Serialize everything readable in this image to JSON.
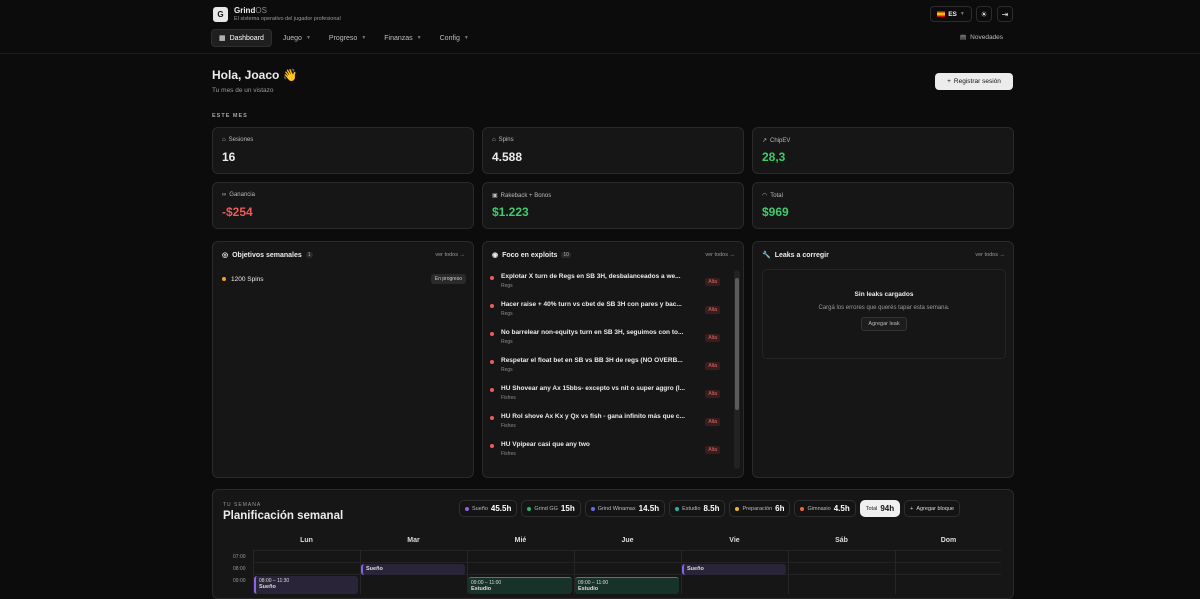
{
  "header": {
    "logo_letter": "G",
    "brand": "Grind",
    "brand_suffix": "OS",
    "tagline": "El sistema operativo del jugador profesional",
    "lang": "ES",
    "nav": [
      {
        "label": "Dashboard",
        "active": true
      },
      {
        "label": "Juego"
      },
      {
        "label": "Progreso"
      },
      {
        "label": "Finanzas"
      },
      {
        "label": "Config"
      }
    ],
    "novedades": "Novedades"
  },
  "greeting": {
    "title": "Hola, Joaco",
    "emoji": "👋",
    "subtitle": "Tu mes de un vistazo",
    "register_button": "Registrar sesión"
  },
  "month_label": "ESTE MES",
  "stats": [
    {
      "label": "Sesiones",
      "value": "16",
      "color": "#ffffff"
    },
    {
      "label": "Spins",
      "value": "4.588",
      "color": "#ffffff"
    },
    {
      "label": "ChipEV",
      "value": "28,3",
      "color": "#3ecb6c"
    },
    {
      "label": "Ganancia",
      "value": "-$254",
      "color": "#ec5a5a"
    },
    {
      "label": "Rakeback + Bonos",
      "value": "$1.223",
      "color": "#3ecb6c"
    },
    {
      "label": "Total",
      "value": "$969",
      "color": "#3ecb6c"
    }
  ],
  "objetivos": {
    "title": "Objetivos semanales",
    "count": "1",
    "link": "ver todos →",
    "items": [
      {
        "label": "1200 Spins",
        "status": "En progreso"
      }
    ]
  },
  "exploits": {
    "title": "Foco en exploits",
    "count": "10",
    "link": "ver todos →",
    "items": [
      {
        "title": "Explotar X turn de Regs en SB 3H, desbalanceados a we...",
        "sub": "Regs",
        "priority": "Alta"
      },
      {
        "title": "Hacer raise + 40% turn vs cbet de SB 3H con pares y bac...",
        "sub": "Regs",
        "priority": "Alta"
      },
      {
        "title": "No barrelear non-equitys turn en SB 3H, seguimos con to...",
        "sub": "Regs",
        "priority": "Alta"
      },
      {
        "title": "Respetar el float bet en SB vs BB 3H de regs (NO OVERB...",
        "sub": "Regs",
        "priority": "Alta"
      },
      {
        "title": "HU Shovear any Ax 15bbs- excepto vs nit o super aggro (I...",
        "sub": "Fishes",
        "priority": "Alta"
      },
      {
        "title": "HU Rol shove Ax Kx y Qx vs fish - gana infinito más que c...",
        "sub": "Fishes",
        "priority": "Alta"
      },
      {
        "title": "HU Vpipear casi que any two",
        "sub": "Fishes",
        "priority": "Alta"
      }
    ]
  },
  "leaks": {
    "title": "Leaks a corregir",
    "link": "ver todos →",
    "empty_title": "Sin leaks cargados",
    "empty_desc": "Cargá los errores que querés tapar esta semana.",
    "add_button": "Agregar leak"
  },
  "week": {
    "label": "TU SEMANA",
    "title": "Planificación semanal",
    "chips": [
      {
        "name": "Sueño",
        "hours": "45.5h",
        "color": "#8a63e6"
      },
      {
        "name": "Grind GG",
        "hours": "15h",
        "color": "#2bb673"
      },
      {
        "name": "Grind Winamax",
        "hours": "14.5h",
        "color": "#6a6ae6"
      },
      {
        "name": "Estudio",
        "hours": "8.5h",
        "color": "#22b5a0"
      },
      {
        "name": "Preparación",
        "hours": "6h",
        "color": "#f0b429"
      },
      {
        "name": "Gimnasio",
        "hours": "4.5h",
        "color": "#f06b2b"
      }
    ],
    "total_label": "Total",
    "total_hours": "94h",
    "add_button": "Agregar bloque",
    "days": [
      "Lun",
      "Mar",
      "Mié",
      "Jue",
      "Vie",
      "Sáb",
      "Dom"
    ],
    "times": [
      "07:00",
      "08:00",
      "09:00"
    ],
    "blocks": {
      "mar": "Sueño",
      "vie": "Sueño",
      "lun_time": "08:00 – 11:30",
      "lun_name": "Sueño",
      "mie_time": "09:00 – 11:00",
      "mie_name": "Estudio",
      "jue_time": "09:00 – 11:00",
      "jue_name": "Estudio"
    }
  }
}
